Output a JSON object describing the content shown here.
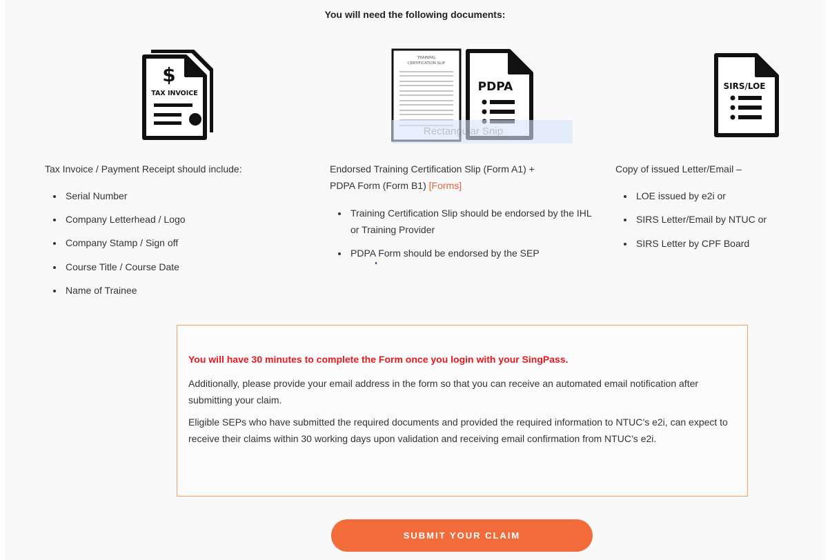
{
  "heading": "You will need the following documents:",
  "col1": {
    "icon_text": "TAX INVOICE",
    "title": "Tax Invoice / Payment Receipt should include:",
    "items": [
      "Serial Number",
      "Company Letterhead / Logo",
      "Company Stamp / Sign off",
      "Course Title / Course Date",
      "Name of Trainee"
    ]
  },
  "col2": {
    "icon_slip_text_1": "TRAINING",
    "icon_slip_text_2": "CERTIFICATION SLIP",
    "icon_pdpa_text": "PDPA",
    "overlay_text": "Rectangular Snip",
    "title_line1": "Endorsed Training Certification Slip (Form A1) +",
    "title_line2_prefix": "PDPA Form (Form B1) ",
    "forms_link": "[Forms]",
    "items": [
      "Training Certification Slip should be endorsed by the IHL or Training Provider",
      "PDPA Form should be endorsed by the SEP"
    ]
  },
  "col3": {
    "icon_text": "SIRS/LOE",
    "title": "Copy of issued Letter/Email –",
    "items": [
      "LOE issued by e2i or",
      "SIRS Letter/Email by NTUC or",
      "SIRS Letter by CPF Board"
    ]
  },
  "notice": {
    "warning": "You will have 30 minutes to complete the Form once you login with your SingPass.",
    "para1": "Additionally, please provide your email address in the form so that you can receive an automated email notification after submitting your claim.",
    "para2": "Eligible SEPs who have submitted the required documents and provided the required information to NTUC’s e2i, can expect to receive their claims within 30 working days upon validation and receiving email confirmation from NTUC’s e2i."
  },
  "submit_label": "SUBMIT YOUR CLAIM",
  "colors": {
    "accent": "#f26b3a",
    "warning": "#e8181c",
    "border": "#f2a25e"
  }
}
